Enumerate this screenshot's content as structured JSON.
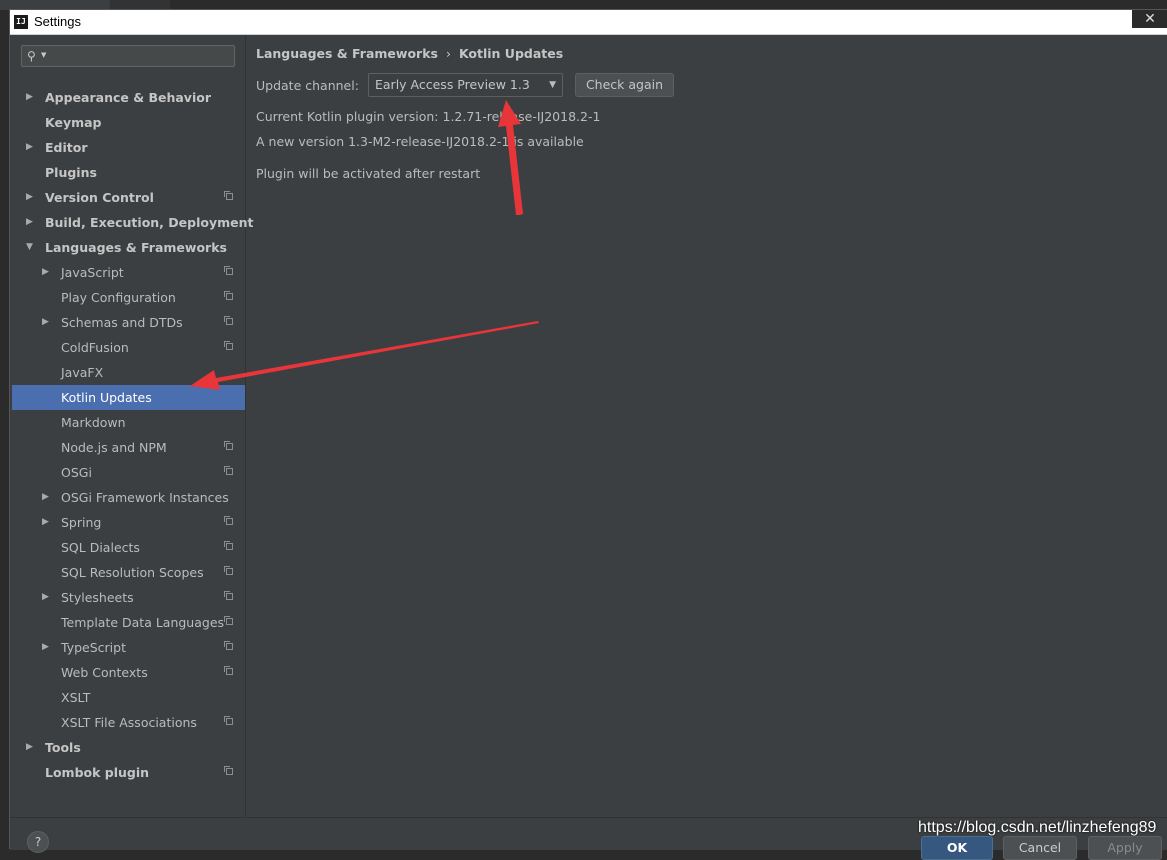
{
  "window": {
    "title": "Settings",
    "app_icon": "IJ",
    "close_glyph": "✕"
  },
  "search": {
    "icon": "search-icon"
  },
  "sidebar": {
    "items": [
      {
        "label": "Appearance & Behavior",
        "level": 0,
        "arrow": "▶",
        "project": false
      },
      {
        "label": "Keymap",
        "level": 0,
        "arrow": "",
        "project": false
      },
      {
        "label": "Editor",
        "level": 0,
        "arrow": "▶",
        "project": false
      },
      {
        "label": "Plugins",
        "level": 0,
        "arrow": "",
        "project": false
      },
      {
        "label": "Version Control",
        "level": 0,
        "arrow": "▶",
        "project": true
      },
      {
        "label": "Build, Execution, Deployment",
        "level": 0,
        "arrow": "▶",
        "project": false
      },
      {
        "label": "Languages & Frameworks",
        "level": 0,
        "arrow": "▼",
        "project": false
      },
      {
        "label": "JavaScript",
        "level": 1,
        "arrow": "▶",
        "project": true
      },
      {
        "label": "Play Configuration",
        "level": 1,
        "arrow": "",
        "project": true
      },
      {
        "label": "Schemas and DTDs",
        "level": 1,
        "arrow": "▶",
        "project": true
      },
      {
        "label": "ColdFusion",
        "level": 1,
        "arrow": "",
        "project": true
      },
      {
        "label": "JavaFX",
        "level": 1,
        "arrow": "",
        "project": false
      },
      {
        "label": "Kotlin Updates",
        "level": 1,
        "arrow": "",
        "project": false,
        "selected": true
      },
      {
        "label": "Markdown",
        "level": 1,
        "arrow": "",
        "project": false
      },
      {
        "label": "Node.js and NPM",
        "level": 1,
        "arrow": "",
        "project": true
      },
      {
        "label": "OSGi",
        "level": 1,
        "arrow": "",
        "project": true
      },
      {
        "label": "OSGi Framework Instances",
        "level": 1,
        "arrow": "▶",
        "project": false
      },
      {
        "label": "Spring",
        "level": 1,
        "arrow": "▶",
        "project": true
      },
      {
        "label": "SQL Dialects",
        "level": 1,
        "arrow": "",
        "project": true
      },
      {
        "label": "SQL Resolution Scopes",
        "level": 1,
        "arrow": "",
        "project": true
      },
      {
        "label": "Stylesheets",
        "level": 1,
        "arrow": "▶",
        "project": true
      },
      {
        "label": "Template Data Languages",
        "level": 1,
        "arrow": "",
        "project": true
      },
      {
        "label": "TypeScript",
        "level": 1,
        "arrow": "▶",
        "project": true
      },
      {
        "label": "Web Contexts",
        "level": 1,
        "arrow": "",
        "project": true
      },
      {
        "label": "XSLT",
        "level": 1,
        "arrow": "",
        "project": false
      },
      {
        "label": "XSLT File Associations",
        "level": 1,
        "arrow": "",
        "project": true
      },
      {
        "label": "Tools",
        "level": 0,
        "arrow": "▶",
        "project": false
      },
      {
        "label": "Lombok plugin",
        "level": 0,
        "arrow": "",
        "project": true
      }
    ]
  },
  "main": {
    "breadcrumb": {
      "parent": "Languages & Frameworks",
      "separator": "›",
      "current": "Kotlin Updates"
    },
    "channel_label": "Update channel:",
    "channel_value": "Early Access Preview 1.3",
    "channel_dropdown_glyph": "▼",
    "check_again_label": "Check again",
    "current_version": "Current Kotlin plugin version:  1.2.71-release-IJ2018.2-1",
    "new_version": "A new version 1.3-M2-release-IJ2018.2-1 is available",
    "restart_note": "Plugin will be activated after restart"
  },
  "footer": {
    "help": "?",
    "ok": "OK",
    "cancel": "Cancel",
    "apply": "Apply"
  },
  "watermark": "https://blog.csdn.net/linzhefeng89",
  "colors": {
    "selection": "#4b6eaf",
    "annotation_arrow": "#e8353a"
  }
}
